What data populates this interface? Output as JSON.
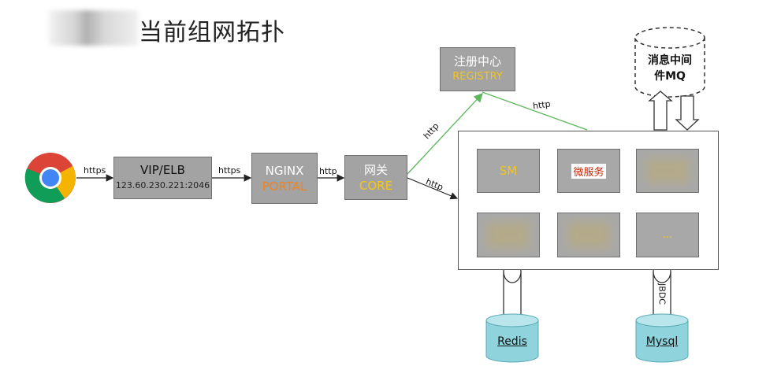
{
  "title": "当前组网拓扑",
  "browser_icon": "chrome-icon",
  "links": {
    "https_1": "https",
    "https_2": "https",
    "http_1": "http",
    "http_up": "http",
    "http_down": "http",
    "http_registry": "http"
  },
  "vip": {
    "name": "VIP/ELB",
    "addr": "123.60.230.221:2046"
  },
  "nginx": {
    "name": "NGINX",
    "sub": "PORTAL"
  },
  "gateway": {
    "name": "网关",
    "sub": "CORE"
  },
  "registry": {
    "name": "注册中心",
    "sub": "REGISTRY"
  },
  "mq": {
    "line1": "消息中间",
    "line2": "件MQ"
  },
  "services": {
    "sm": "SM",
    "micro": "微服务",
    "ellipsis": "..."
  },
  "redis": {
    "name": "Redis"
  },
  "mysql": {
    "name": "Mysql",
    "connector": "JBDC"
  },
  "colors": {
    "box": "#a3a3a3",
    "orange": "#f0841f",
    "yellow": "#f5c518",
    "green_line": "#5cb85c",
    "db_fill": "#8fd3dc"
  }
}
